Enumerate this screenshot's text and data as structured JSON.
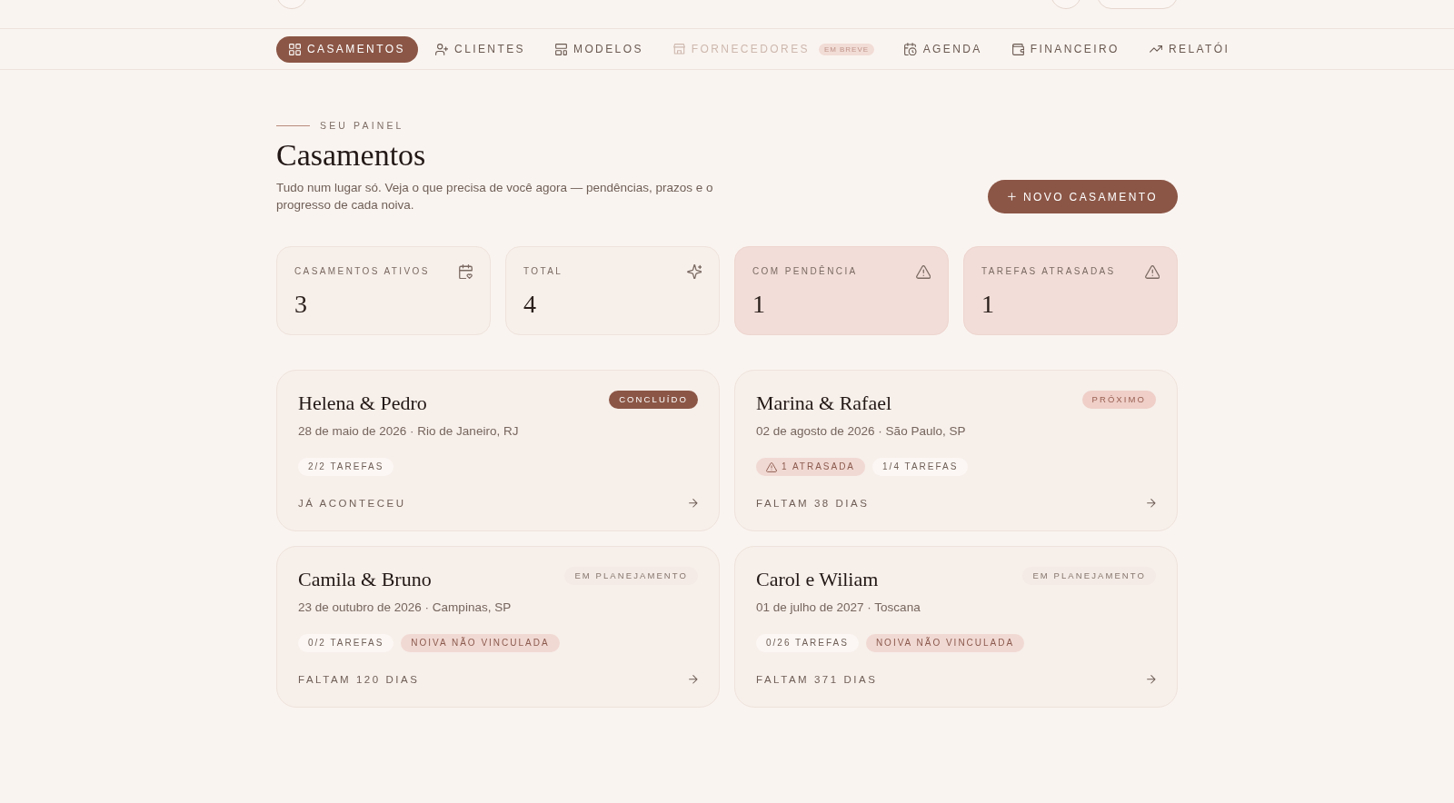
{
  "nav": {
    "tabs": [
      {
        "label": "CASAMENTOS",
        "selected": true,
        "disabled": false
      },
      {
        "label": "CLIENTES",
        "selected": false,
        "disabled": false
      },
      {
        "label": "MODELOS",
        "selected": false,
        "disabled": false
      },
      {
        "label": "FORNECEDORES",
        "selected": false,
        "disabled": true,
        "badge": "EM BREVE"
      },
      {
        "label": "AGENDA",
        "selected": false,
        "disabled": false
      },
      {
        "label": "FINANCEIRO",
        "selected": false,
        "disabled": false
      },
      {
        "label": "RELATÓI",
        "selected": false,
        "disabled": false
      }
    ]
  },
  "header": {
    "eyebrow": "SEU PAINEL",
    "title": "Casamentos",
    "description": "Tudo num lugar só. Veja o que precisa de você agora — pendências, prazos e o progresso de cada noiva.",
    "new_button": "NOVO CASAMENTO"
  },
  "stats": [
    {
      "label": "CASAMENTOS ATIVOS",
      "value": "3",
      "alert": false
    },
    {
      "label": "TOTAL",
      "value": "4",
      "alert": false
    },
    {
      "label": "COM PENDÊNCIA",
      "value": "1",
      "alert": true
    },
    {
      "label": "TAREFAS ATRASADAS",
      "value": "1",
      "alert": true
    }
  ],
  "weddings": [
    {
      "couple": "Helena & Pedro",
      "date_place": "28 de maio de 2026 · Rio de Janeiro, RJ",
      "status": {
        "label": "CONCLUÍDO",
        "kind": "done"
      },
      "chips": [
        {
          "label": "2/2 TAREFAS",
          "kind": "tasks"
        }
      ],
      "countdown": "JÁ ACONTECEU"
    },
    {
      "couple": "Marina & Rafael",
      "date_place": "02 de agosto de 2026 · São Paulo, SP",
      "status": {
        "label": "PRÓXIMO",
        "kind": "upcoming"
      },
      "chips": [
        {
          "label": "1 ATRASADA",
          "kind": "overdue"
        },
        {
          "label": "1/4 TAREFAS",
          "kind": "tasks"
        }
      ],
      "countdown": "FALTAM 38 DIAS"
    },
    {
      "couple": "Camila & Bruno",
      "date_place": "23 de outubro de 2026 · Campinas, SP",
      "status": {
        "label": "EM PLANEJAMENTO",
        "kind": "planning"
      },
      "chips": [
        {
          "label": "0/2 TAREFAS",
          "kind": "tasks"
        },
        {
          "label": "NOIVA NÃO VINCULADA",
          "kind": "unlinked"
        }
      ],
      "countdown": "FALTAM 120 DIAS"
    },
    {
      "couple": "Carol e Wiliam",
      "date_place": "01 de julho de 2027 · Toscana",
      "status": {
        "label": "EM PLANEJAMENTO",
        "kind": "planning"
      },
      "chips": [
        {
          "label": "0/26 TAREFAS",
          "kind": "tasks"
        },
        {
          "label": "NOIVA NÃO VINCULADA",
          "kind": "unlinked"
        }
      ],
      "countdown": "FALTAM 371 DIAS"
    }
  ]
}
